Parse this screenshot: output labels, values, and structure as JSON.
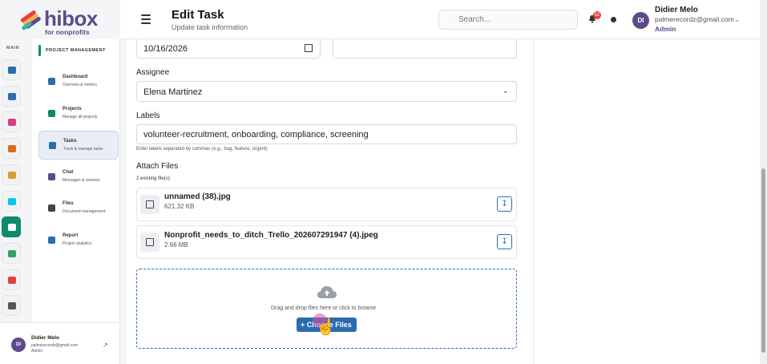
{
  "brand": {
    "name": "hibox",
    "tagline": "for nonprofits"
  },
  "header": {
    "title": "Edit Task",
    "subtitle": "Update task information",
    "search_placeholder": "Search...",
    "notification_count": "52",
    "user": {
      "initials": "DI",
      "name": "Didier Melo",
      "email": "palmerecordz@gmail.com",
      "role": "Admin"
    }
  },
  "rail": {
    "section_label": "MAIN",
    "items": [
      {
        "icon": "home-icon",
        "color": "#2b6cb0"
      },
      {
        "icon": "hierarchy-icon",
        "color": "#2b6cb0"
      },
      {
        "icon": "handshake-icon",
        "color": "#d53f8c"
      },
      {
        "icon": "book-icon",
        "color": "#dd6b20"
      },
      {
        "icon": "graduation-icon",
        "color": "#d69e2e"
      },
      {
        "icon": "virus-icon",
        "color": "#0bc5ea"
      },
      {
        "icon": "project-icon",
        "color": "#ffffff",
        "active": true
      },
      {
        "icon": "people-icon",
        "color": "#38a169"
      },
      {
        "icon": "pie-chart-icon",
        "color": "#e53e3e"
      },
      {
        "icon": "gear-icon",
        "color": "#555555"
      }
    ]
  },
  "sidebar": {
    "section_label": "PROJECT MANAGEMENT",
    "items": [
      {
        "title": "Dashboard",
        "desc": "Overview & metrics",
        "icon": "dashboard-icon",
        "color": "#2b6cb0"
      },
      {
        "title": "Projects",
        "desc": "Manage all projects",
        "icon": "projects-icon",
        "color": "#0e8a6c"
      },
      {
        "title": "Tasks",
        "desc": "Track & manage tasks",
        "icon": "tasks-icon",
        "color": "#2b6cb0",
        "active": true
      },
      {
        "title": "Chat",
        "desc": "Messages & streams",
        "icon": "chat-icon",
        "color": "#5d4a8a"
      },
      {
        "title": "Files",
        "desc": "Document management",
        "icon": "folder-icon",
        "color": "#444444"
      },
      {
        "title": "Report",
        "desc": "Project analytics",
        "icon": "report-icon",
        "color": "#2b6cb0"
      }
    ],
    "footer": {
      "initials": "DI",
      "name": "Didier Melo",
      "email": "palmerecordz@gmail.com",
      "role": "Admin"
    }
  },
  "form": {
    "due_date": "10/16/2026",
    "other_field": "",
    "assignee_label": "Assignee",
    "assignee_value": "Elena Martinez",
    "labels_label": "Labels",
    "labels_value": "volunteer-recruitment, onboarding, compliance, screening",
    "labels_hint": "Enter labels separated by commas (e.g., bug, feature, urgent)",
    "attach_label": "Attach Files",
    "existing_count": "2 existing file(s):",
    "files": [
      {
        "name": "unnamed (38).jpg",
        "size": "621.32 KB"
      },
      {
        "name": "Nonprofit_needs_to_ditch_Trello_202607291947 (4).jpeg",
        "size": "2.66 MB"
      }
    ],
    "drop_text": "Drag and drop files here or click to browse",
    "choose_button": "+ Choose Files"
  },
  "colors": {
    "brand": "#5d4a8a",
    "accent": "#2b6cb0",
    "active_green": "#0e8a6c"
  }
}
